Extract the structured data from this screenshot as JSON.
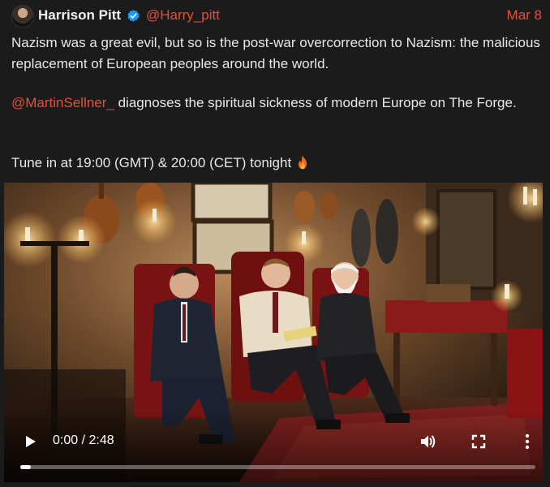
{
  "post": {
    "author_name": "Harrison Pitt",
    "handle": "@Harry_pitt",
    "date": "Mar 8",
    "paragraph1": "Nazism was a great evil, but so is the post-war overcorrection to Nazism: the malicious replacement of European peoples around the world.",
    "mention": "@MartinSellner_",
    "paragraph2_rest": " diagnoses the spiritual sickness of modern Europe on The Forge.",
    "paragraph3": "Tune in at 19:00 (GMT) & 20:00 (CET) tonight"
  },
  "video": {
    "time": "0:00 / 2:48",
    "progress": 0.02
  },
  "colors": {
    "accent": "#e2513b",
    "verified": "#1d9bf0",
    "background": "#1b1b1b"
  },
  "icons": [
    "verified-badge-icon",
    "fire-emoji-icon",
    "play-icon",
    "volume-icon",
    "fullscreen-icon",
    "more-options-icon"
  ]
}
